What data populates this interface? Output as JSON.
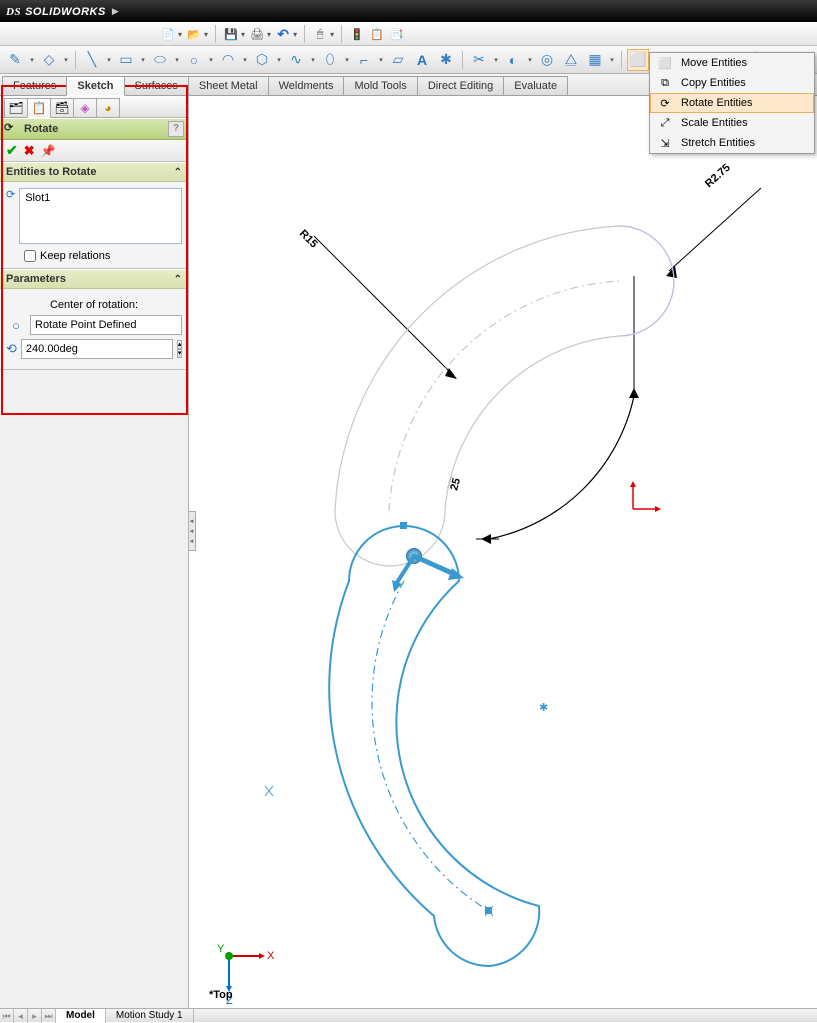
{
  "app": {
    "title": "SOLIDWORKS"
  },
  "cmdtabs": {
    "items": [
      "Features",
      "Sketch",
      "Surfaces",
      "Sheet Metal",
      "Weldments",
      "Mold Tools",
      "Direct Editing",
      "Evaluate"
    ],
    "active": "Sketch"
  },
  "dropdown": {
    "items": [
      {
        "label": "Move Entities",
        "icon": "⬜"
      },
      {
        "label": "Copy Entities",
        "icon": "⧉"
      },
      {
        "label": "Rotate Entities",
        "icon": "⟳",
        "selected": true
      },
      {
        "label": "Scale Entities",
        "icon": "⤢"
      },
      {
        "label": "Stretch Entities",
        "icon": "⇲"
      }
    ]
  },
  "propmgr": {
    "title": "Rotate",
    "entities": {
      "header": "Entities to Rotate",
      "list": [
        "Slot1"
      ],
      "keep_relations_label": "Keep relations",
      "keep_relations_checked": false
    },
    "params": {
      "header": "Parameters",
      "center_label": "Center of rotation:",
      "point_value": "Rotate Point Defined",
      "angle_value": "240.00deg"
    }
  },
  "dims": {
    "r_outer": "R15",
    "r_inner": "R2.75",
    "len": "25"
  },
  "viewlabel": "*Top",
  "triad_axes": {
    "x": "X",
    "y": "Y",
    "z": "Z"
  },
  "bottomtabs": {
    "items": [
      "Model",
      "Motion Study 1"
    ],
    "active": "Model"
  }
}
